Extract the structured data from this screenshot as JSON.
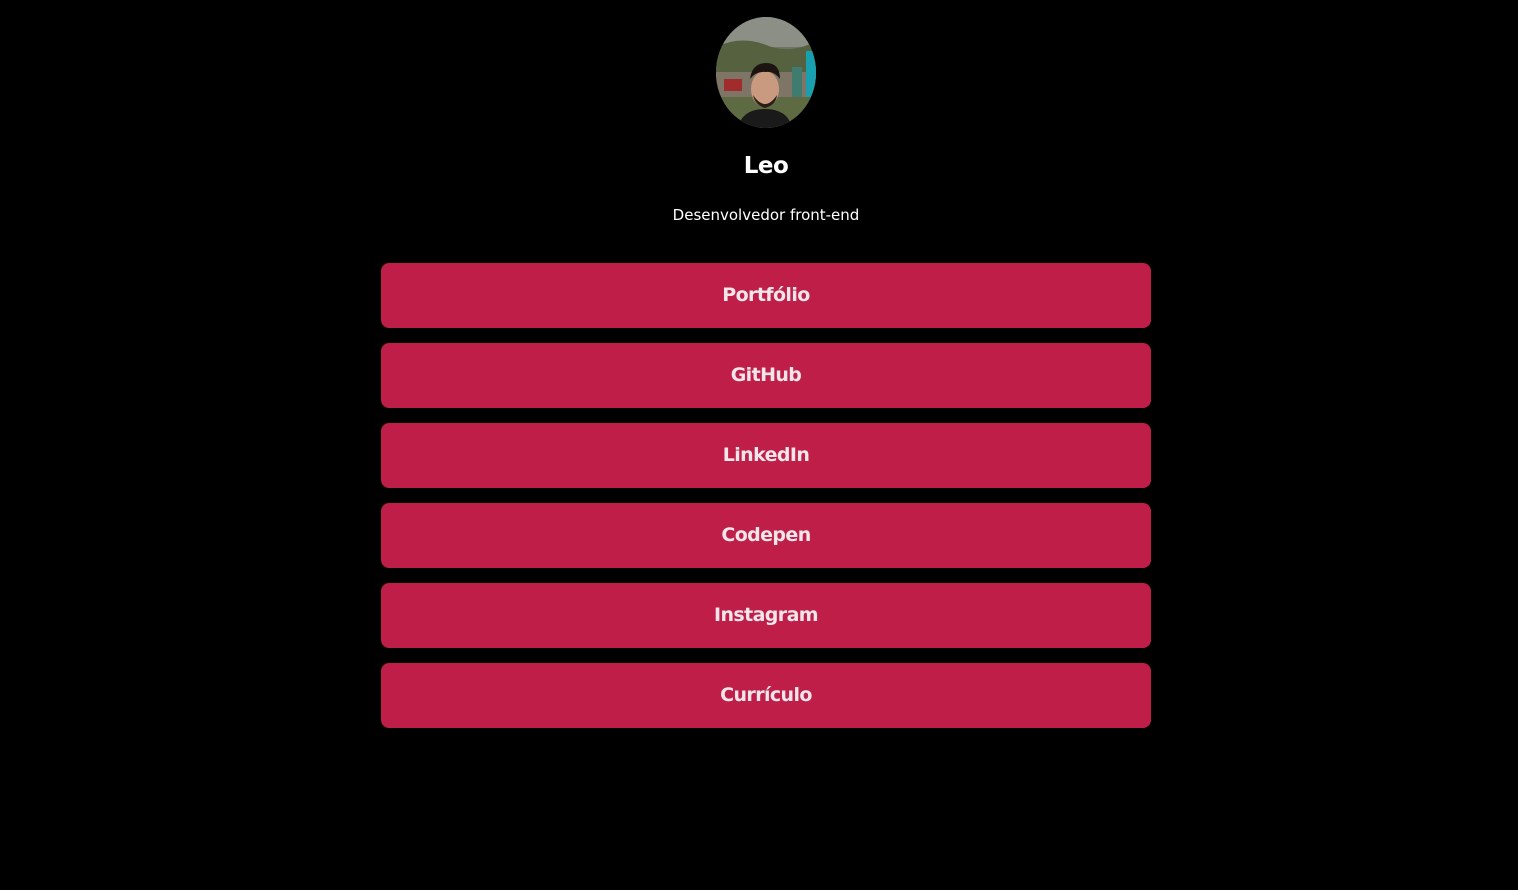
{
  "profile": {
    "name": "Leo",
    "subtitle": "Desenvolvedor front-end",
    "avatar_icon": "profile-photo"
  },
  "links": [
    {
      "label": "Portfólio"
    },
    {
      "label": "GitHub"
    },
    {
      "label": "LinkedIn"
    },
    {
      "label": "Codepen"
    },
    {
      "label": "Instagram"
    },
    {
      "label": "Currículo"
    }
  ],
  "colors": {
    "background": "#000000",
    "button": "#be1e47",
    "button_text": "#f3e6ea",
    "text": "#ffffff"
  }
}
